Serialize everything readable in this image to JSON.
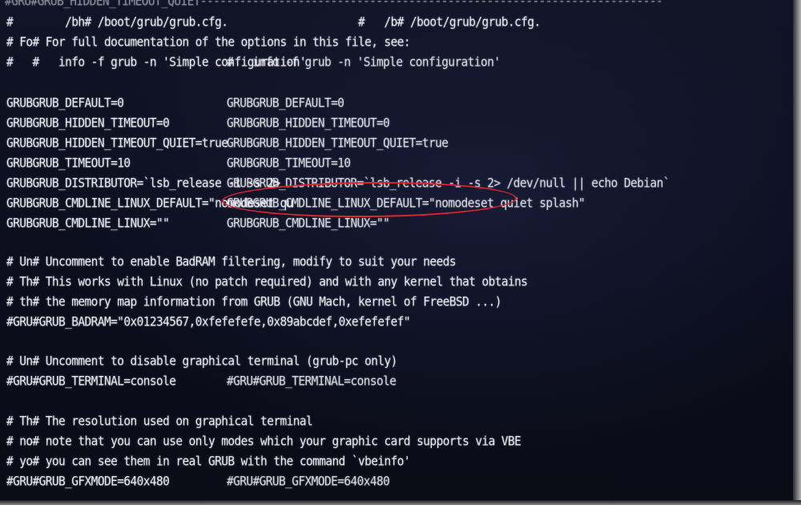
{
  "terminal": {
    "header_line": "#        /bh# /boot/grub/grub.cfg.                    #   /b# /boot/grub/grub.cfg.",
    "doc_line": "# Fo# For full documentation of the options in this file, see:",
    "doc_line_right": "this file, see:",
    "info_line": "#   #   info -f grub -n 'Simple configuration'",
    "info_line_right": "#   info -f grub -n 'Simple configuration'",
    "left_column": [
      "GRUBGRUB_DEFAULT=0",
      "GRUBGRUB_HIDDEN_TIMEOUT=0",
      "GRUBGRUB_HIDDEN_TIMEOUT_QUIET=true",
      "GRUBGRUB_TIMEOUT=10",
      "GRUBGRUB_DISTRIBUTOR=`lsb_release -i -s 2>",
      "GRUBGRUB_CMDLINE_LINUX_DEFAULT=\"nomodeset qu",
      "GRUBGRUB_CMDLINE_LINUX=\"\""
    ],
    "right_column": [
      "GRUBGRUB_DEFAULT=0",
      "GRUBGRUB_HIDDEN_TIMEOUT=0",
      "GRUBGRUB_HIDDEN_TIMEOUT_QUIET=true",
      "GRUBGRUB_TIMEOUT=10",
      "GRUBGRUB_DISTRIBUTOR=`lsb_release -i -s 2> /dev/null || echo Debian`",
      "GRUBGRUB_CMDLINE_LINUX_DEFAULT=\"nomodeset quiet splash\"",
      "GRUBGRUB_CMDLINE_LINUX=\"\""
    ],
    "badram_block": [
      "# Un# Uncomment to enable BadRAM filtering, modify to suit your needs",
      "# Th# This works with Linux (no patch required) and with any kernel that obtains",
      "# th# the memory map information from GRUB (GNU Mach, kernel of FreeBSD ...)",
      "#GRU#GRUB_BADRAM=\"0x01234567,0xfefefefe,0x89abcdef,0xefefefef\""
    ],
    "terminal_block": [
      "# Un# Uncomment to disable graphical terminal (grub-pc only)",
      "#GRU#GRUB_TERMINAL=console",
      "#GRU#GRUB_TERMINAL=console"
    ],
    "gfx_block": [
      "# Th# The resolution used on graphical terminal",
      "# no# note that you can use only modes which your graphic card supports via VBE",
      "# yo# you can see them in real GRUB with the command `vbeinfo'",
      "#GRU#GRUB_GFXMODE=640x480",
      "#GRU#GRUB_GFXMODE=640x480"
    ]
  },
  "colors": {
    "text": "#e8eaf2",
    "background": "#0c0e1a",
    "annotation": "#e0242c"
  }
}
